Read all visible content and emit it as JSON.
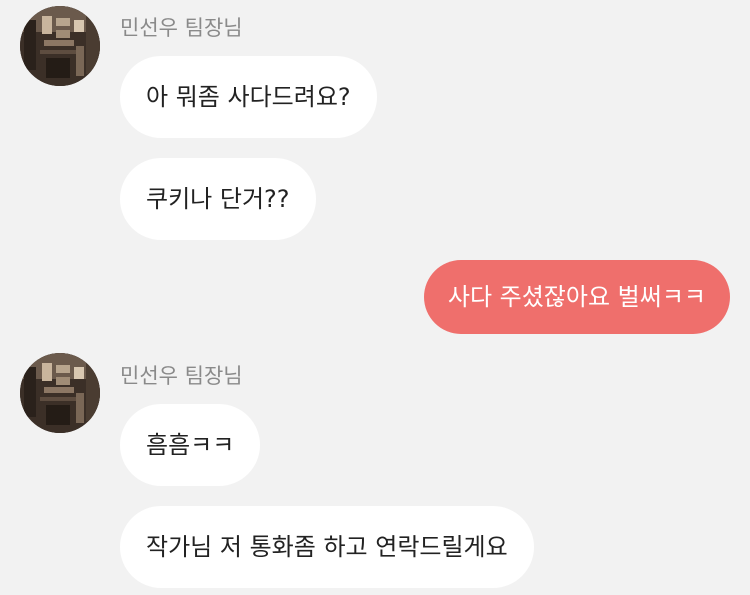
{
  "colors": {
    "background": "#f2f2f2",
    "incoming_bubble": "#ffffff",
    "outgoing_bubble": "#ef6f6c",
    "sender_name": "#8a8a8a",
    "text": "#222222"
  },
  "messages": [
    {
      "sender": "민선우 팀장님",
      "avatar": "photo-avatar",
      "bubbles": [
        "아 뭐좀 사다드려요?",
        "쿠키나 단거??"
      ]
    },
    {
      "outgoing": true,
      "text": "사다 주셨잖아요 벌써ㅋㅋ"
    },
    {
      "sender": "민선우 팀장님",
      "avatar": "photo-avatar",
      "bubbles": [
        "흠흠ㅋㅋ",
        "작가님 저 통화좀 하고 연락드릴게요"
      ]
    }
  ]
}
